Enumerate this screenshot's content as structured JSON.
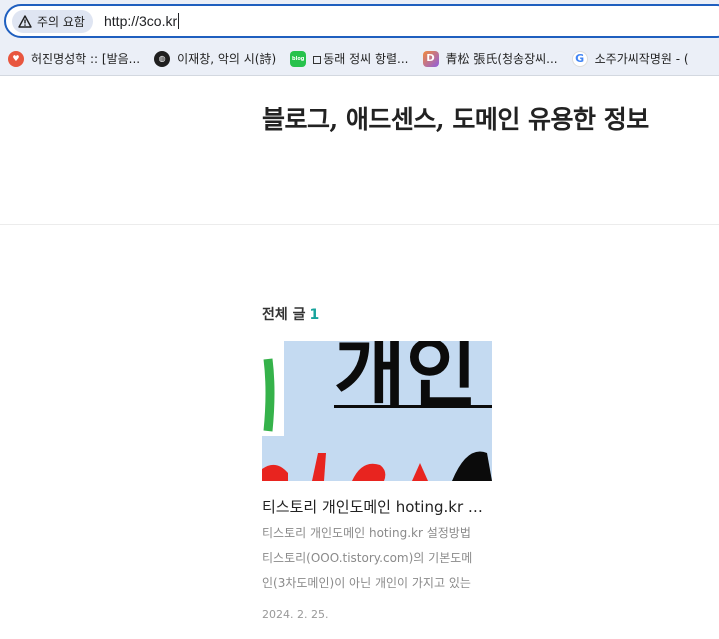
{
  "browser": {
    "security_chip": "주의 요함",
    "url": "http://3co.kr"
  },
  "bookmarks": [
    {
      "label": "허진명성학 :: [발음...",
      "icon": "red-circle-icon"
    },
    {
      "label": "이재창, 악의 시(詩)",
      "icon": "globe-icon"
    },
    {
      "label": "동래 정씨 항렬...",
      "icon": "blog-icon",
      "prefix_icon": "square-icon"
    },
    {
      "label": "青松 張氏(청송장씨...",
      "icon": "d-icon"
    },
    {
      "label": "소주가씨작명원 - (",
      "icon": "google-icon"
    }
  ],
  "page": {
    "blog_title": "블로그, 애드센스, 도메인 유용한 정보",
    "section_label": "전체 글",
    "section_count": "1",
    "post": {
      "thumbnail_text": "개인",
      "title": "티스토리 개인도메인 hoting.kr 설정방법",
      "excerpt": "티스토리 개인도메인 hoting.kr 설정방법 티스토리(OOO.tistory.com)의 기본도메인(3차도메인)이 아닌 개인이 가지고 있는 도메인으로 연결하는 방법",
      "date": "2024. 2. 25."
    }
  },
  "colors": {
    "accent": "#17a39c",
    "omnibox_border": "#1f5fbf",
    "thumbnail_bg": "#c4daf1"
  }
}
